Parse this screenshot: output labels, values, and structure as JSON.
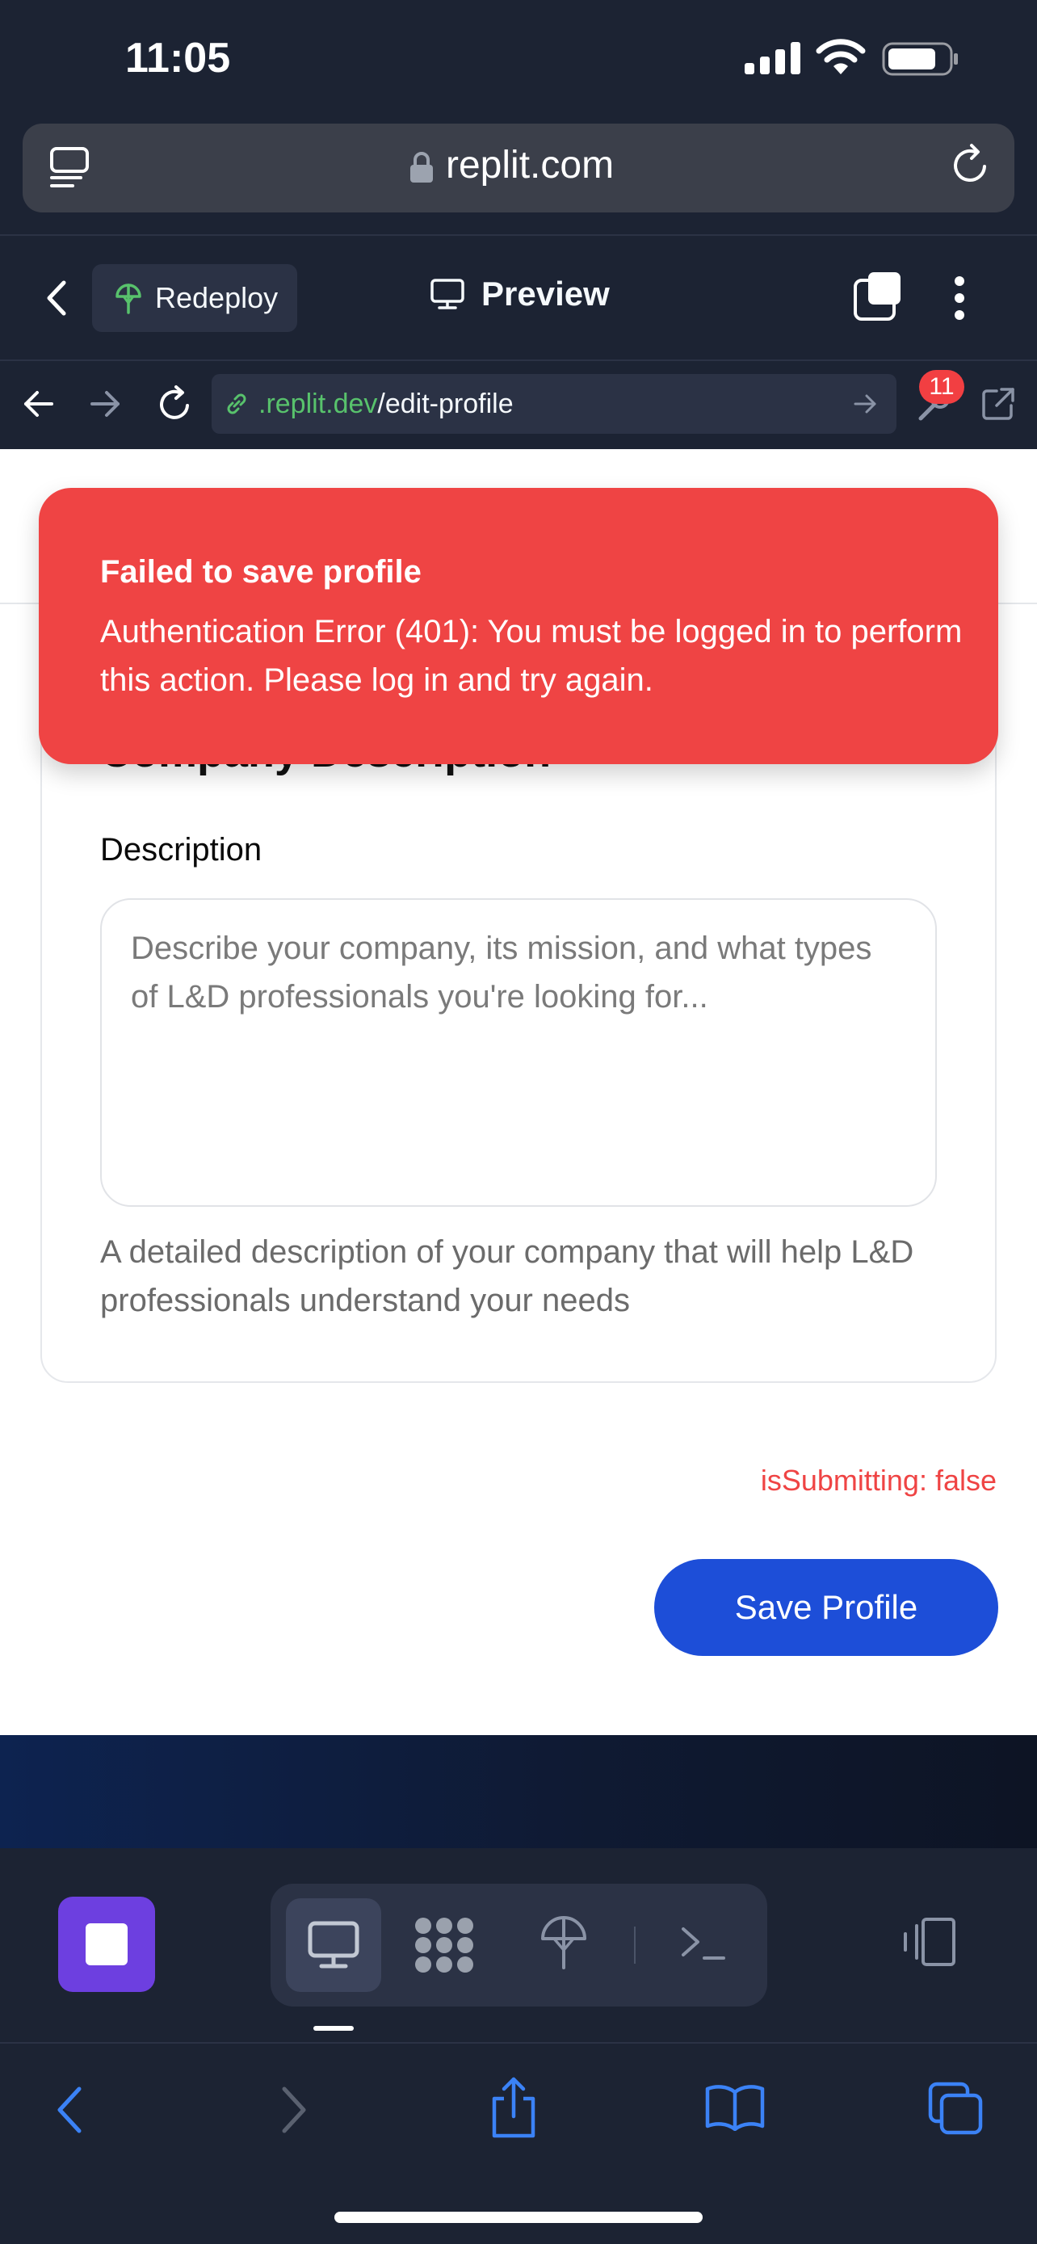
{
  "status_bar": {
    "time": "11:05"
  },
  "safari": {
    "domain": "replit.com"
  },
  "replit_header": {
    "redeploy_label": "Redeploy",
    "preview_label": "Preview"
  },
  "browser_nav": {
    "url_host": ".replit.dev",
    "url_path": "/edit-profile",
    "badge_count": "11"
  },
  "page": {
    "card_title": "Company Description",
    "description_label": "Description",
    "description_placeholder": "Describe your company, its mission, and what types of L&D professionals you're looking for...",
    "description_value": "",
    "help_text": "A detailed description of your company that will help L&D professionals understand your needs",
    "debug_text": "isSubmitting: false",
    "save_button": "Save Profile"
  },
  "toast": {
    "title": "Failed to save profile",
    "message": "Authentication Error (401): You must be logged in to perform this action. Please log in and try again."
  },
  "colors": {
    "toast_bg": "#ef4444",
    "primary_button": "#1d4ed8",
    "stop_button": "#6d3fe0",
    "url_host": "#58c26c",
    "ios_blue": "#3b82f6"
  },
  "icons": [
    "signal-icon",
    "wifi-icon",
    "battery-icon",
    "tabs-overview-icon",
    "lock-icon",
    "reload-icon",
    "chevron-left-icon",
    "redeploy-icon",
    "monitor-icon",
    "window-icon",
    "more-icon",
    "arrow-left-icon",
    "arrow-right-icon",
    "refresh-icon",
    "link-icon",
    "go-arrow-icon",
    "wrench-icon",
    "external-link-icon",
    "stop-icon",
    "workflow-icon",
    "deploy-icon",
    "shell-icon",
    "device-icon",
    "share-icon",
    "bookmarks-icon",
    "tabs-icon"
  ]
}
